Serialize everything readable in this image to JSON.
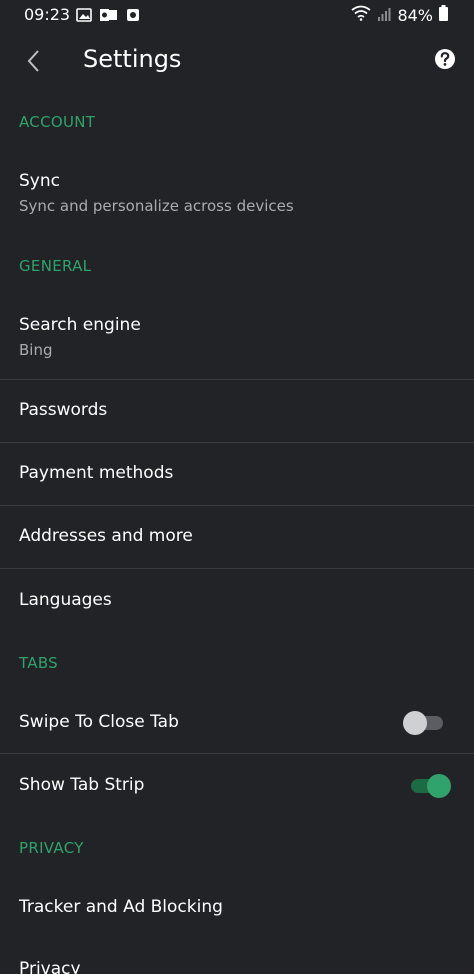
{
  "status_bar": {
    "time": "09:23",
    "battery_pct": "84%"
  },
  "app_bar": {
    "title": "Settings"
  },
  "sections": {
    "account": {
      "header": "ACCOUNT",
      "sync_title": "Sync",
      "sync_subtitle": "Sync and personalize across devices"
    },
    "general": {
      "header": "GENERAL",
      "search_engine_title": "Search engine",
      "search_engine_value": "Bing",
      "passwords": "Passwords",
      "payment_methods": "Payment methods",
      "addresses": "Addresses and more",
      "languages": "Languages"
    },
    "tabs": {
      "header": "TABS",
      "swipe_to_close": "Swipe To Close Tab",
      "swipe_to_close_enabled": false,
      "show_tab_strip": "Show Tab Strip",
      "show_tab_strip_enabled": true
    },
    "privacy": {
      "header": "PRIVACY",
      "tracker_blocking": "Tracker and Ad Blocking",
      "privacy": "Privacy"
    }
  },
  "colors": {
    "background": "#222327",
    "accent": "#2fa36b",
    "subtitle": "#a9abaf",
    "divider": "#3a3b40"
  }
}
